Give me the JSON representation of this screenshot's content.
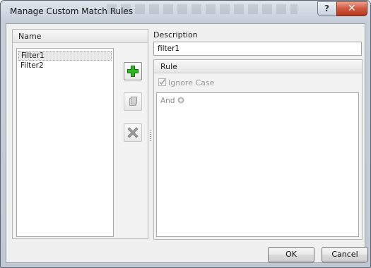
{
  "window": {
    "title": "Manage Custom Match Rules",
    "help_glyph": "?",
    "close_glyph": "✕"
  },
  "left_panel": {
    "column_header": "Name",
    "items": [
      {
        "label": "Filter1",
        "selected": true
      },
      {
        "label": "Filter2",
        "selected": false
      }
    ],
    "buttons": [
      {
        "name": "add-filter-button",
        "icon": "plus-icon",
        "color": "#2fb51f",
        "enabled": true
      },
      {
        "name": "duplicate-filter-button",
        "icon": "copy-icon",
        "enabled": false
      },
      {
        "name": "delete-filter-button",
        "icon": "delete-x-icon",
        "enabled": false
      }
    ]
  },
  "description": {
    "label": "Description",
    "value": "filter1"
  },
  "rule": {
    "header": "Rule",
    "ignore_case_label": "Ignore Case",
    "ignore_case_checked": true,
    "and_label": "And"
  },
  "footer": {
    "ok_label": "OK",
    "cancel_label": "Cancel"
  },
  "colors": {
    "close_button": "#c8412a",
    "add_icon_green": "#2fb51f"
  }
}
